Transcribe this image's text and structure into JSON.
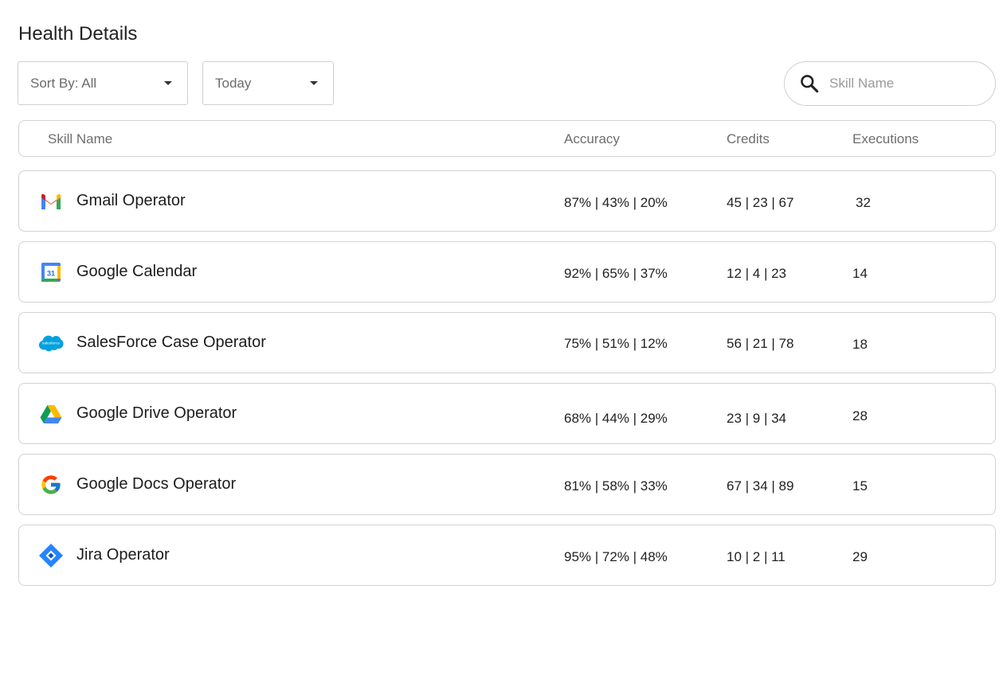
{
  "page": {
    "title": "Health Details"
  },
  "filters": {
    "sort_label": "Sort By: All",
    "range_label": "Today"
  },
  "search": {
    "placeholder": "Skill Name",
    "value": ""
  },
  "table": {
    "columns": [
      "Skill Name",
      "Accuracy",
      "Credits",
      "Executions"
    ],
    "rows": [
      {
        "icon": "gmail-icon",
        "name": "Gmail Operator",
        "accuracy": "87% | 43% | 20%",
        "credits": "45 | 23 | 67",
        "executions": "32"
      },
      {
        "icon": "google-calendar-icon",
        "name": "Google Calendar",
        "accuracy": "92% | 65% | 37%",
        "credits": "12 | 4 | 23",
        "executions": "14"
      },
      {
        "icon": "salesforce-icon",
        "name": "SalesForce Case Operator",
        "accuracy": "75% | 51% | 12%",
        "credits": "56 | 21 | 78",
        "executions": "18"
      },
      {
        "icon": "google-drive-icon",
        "name": "Google Drive Operator",
        "accuracy": "68% | 44% | 29%",
        "credits": "23 | 9 | 34",
        "executions": "28"
      },
      {
        "icon": "google-icon",
        "name": "Google Docs Operator",
        "accuracy": "81% | 58% | 33%",
        "credits": "67 | 34 | 89",
        "executions": "15"
      },
      {
        "icon": "jira-icon",
        "name": "Jira Operator",
        "accuracy": "95% | 72% | 48%",
        "credits": "10 | 2 | 11",
        "executions": "29"
      }
    ]
  },
  "icon_labels": {
    "calendar_day": "31",
    "salesforce": "salesforce"
  }
}
